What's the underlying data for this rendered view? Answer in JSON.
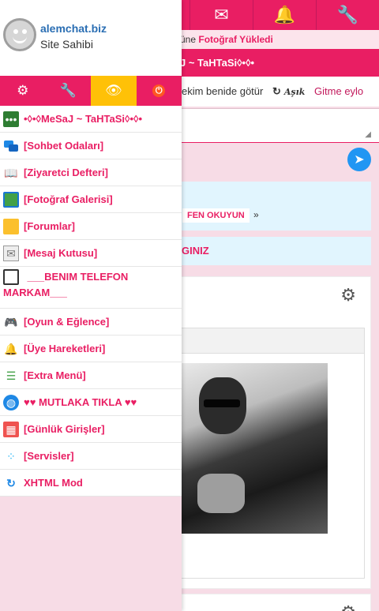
{
  "background": {
    "notice": {
      "prefix": "üne ",
      "highlight": "Fotoğraf Yükledi"
    },
    "title": "J ~ TaHTaSi◊•◊•",
    "marquee": {
      "text": "ekim benide götür",
      "brand": "Aşık",
      "link": "Gitme eylo"
    },
    "info_box": {
      "pill": "FEN OKUYUN",
      "arrow": "»"
    },
    "info_box2": "GINIZ",
    "colors": {
      "primary": "#e91e63",
      "accent": "#ffc107",
      "info": "#e1f5fe",
      "link": "#2a6eb3"
    }
  },
  "profile": {
    "site_name": "alemchat.biz",
    "role": "Site Sahibi"
  },
  "tabs": [
    {
      "icon": "gear-icon",
      "glyph": "⚙"
    },
    {
      "icon": "wrench-icon",
      "glyph": "🔧"
    },
    {
      "icon": "eye-icon",
      "glyph": "👁",
      "active": true
    },
    {
      "icon": "power-icon",
      "glyph": "⏻"
    }
  ],
  "menu": {
    "items": [
      {
        "icon": "chat-icon",
        "label": "•◊•◊MeSaJ ~ TaHTaSi◊•◊•"
      },
      {
        "icon": "chat-rooms-icon",
        "label": "[Sohbet Odaları]"
      },
      {
        "icon": "guestbook-icon",
        "label": "[Ziyaretci Defteri]"
      },
      {
        "icon": "photo-gallery-icon",
        "label": "[Fotoğraf Galerisi]"
      },
      {
        "icon": "folder-icon",
        "label": "[Forumlar]"
      },
      {
        "icon": "mail-icon",
        "label": "[Mesaj Kutusu]"
      },
      {
        "icon": "clipboard-icon",
        "label": "___BENIM TELEFON MARKAM___"
      },
      {
        "icon": "gamepad-icon",
        "label": "[Oyun & Eğlence]"
      },
      {
        "icon": "bell-icon",
        "label": "[Üye Hareketleri]"
      },
      {
        "icon": "list-icon",
        "label": "[Extra Menü]"
      },
      {
        "icon": "globe-icon",
        "label": "♥♥ MUTLAKA TIKLA ♥♥"
      },
      {
        "icon": "calendar-icon",
        "label": "[Günlük Girişler]"
      },
      {
        "icon": "services-icon",
        "label": "[Servisler]"
      },
      {
        "icon": "refresh-icon",
        "label": "XHTML Mod"
      }
    ]
  }
}
